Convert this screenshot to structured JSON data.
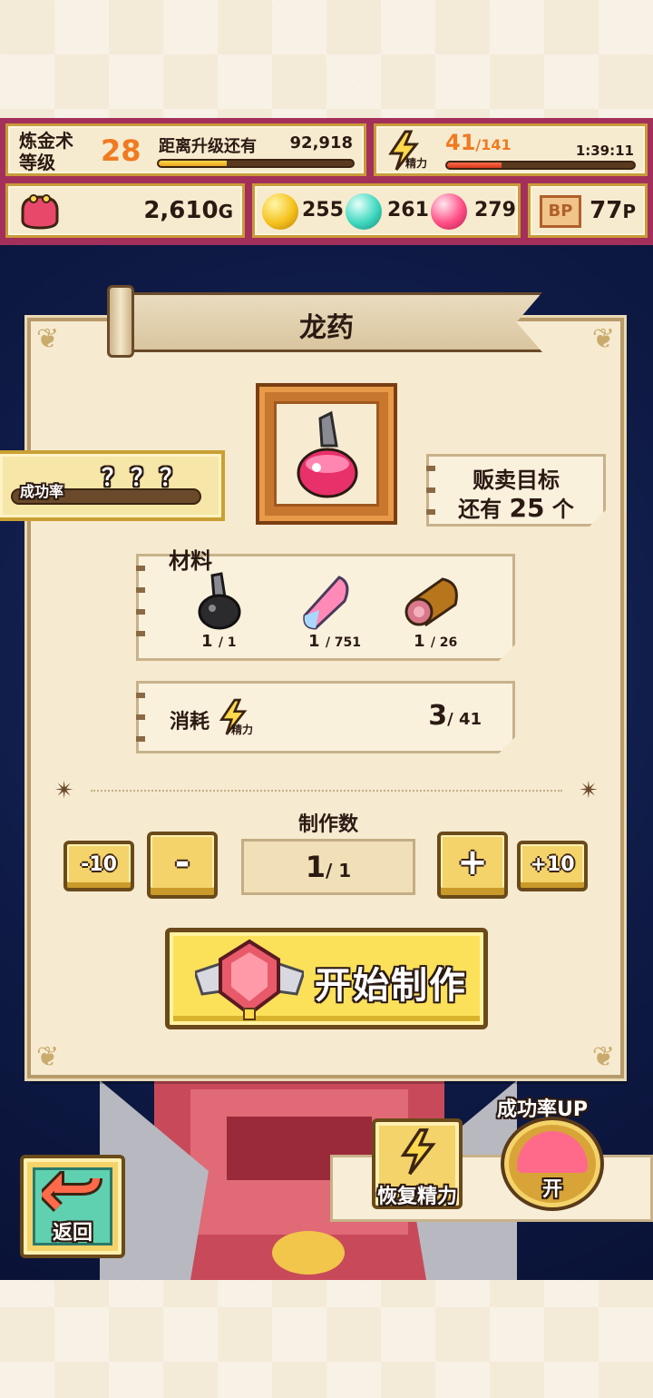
{
  "hud": {
    "level_label": "炼金术\n等级",
    "level": "28",
    "next_level_label": "距离升级还有",
    "next_level_value": "92,918",
    "exp_progress": 0.35,
    "stamina_current": "41",
    "stamina_max": "/141",
    "stamina_icon_label": "精力",
    "stamina_timer": "1:39:11",
    "stamina_progress": 0.29,
    "gold": "2,610",
    "gold_unit": "G",
    "gem_yellow": "255",
    "gem_teal": "261",
    "gem_pink": "279",
    "bp_label": "BP",
    "bp_value": "77",
    "bp_unit": "P"
  },
  "panel": {
    "title": "龙药",
    "success_label": "成功率",
    "success_value": "？？？",
    "sell_target_line1": "贩卖目标",
    "sell_target_prefix": "还有",
    "sell_target_count": "25",
    "sell_target_suffix": "个",
    "materials_label": "材料",
    "materials": [
      {
        "icon": "black-flask-icon",
        "have": "1",
        "need": "/ 1"
      },
      {
        "icon": "crystal-shard-icon",
        "have": "1",
        "need": "/ 751"
      },
      {
        "icon": "meat-roll-icon",
        "have": "1",
        "need": "/ 26"
      }
    ],
    "cost_label": "消耗",
    "cost_icon_label": "精力",
    "cost_value": "3",
    "cost_total": "/ 41",
    "qty_label": "制作数",
    "qty_value": "1",
    "qty_max": "/ 1",
    "btn_minus10": "-10",
    "btn_minus": "-",
    "btn_plus": "+",
    "btn_plus10": "+10",
    "start_label": "开始制作"
  },
  "bottom": {
    "back_label": "返回",
    "restore_label": "恢复精力",
    "rate_up_label": "成功率UP",
    "rate_up_toggle": "开"
  },
  "colors": {
    "hud_bg": "#a3305a",
    "panel_bg": "#f6ead0",
    "accent_orange": "#f07a22",
    "button_yellow": "#f3d36a",
    "game_bg": "#0e1a44"
  }
}
